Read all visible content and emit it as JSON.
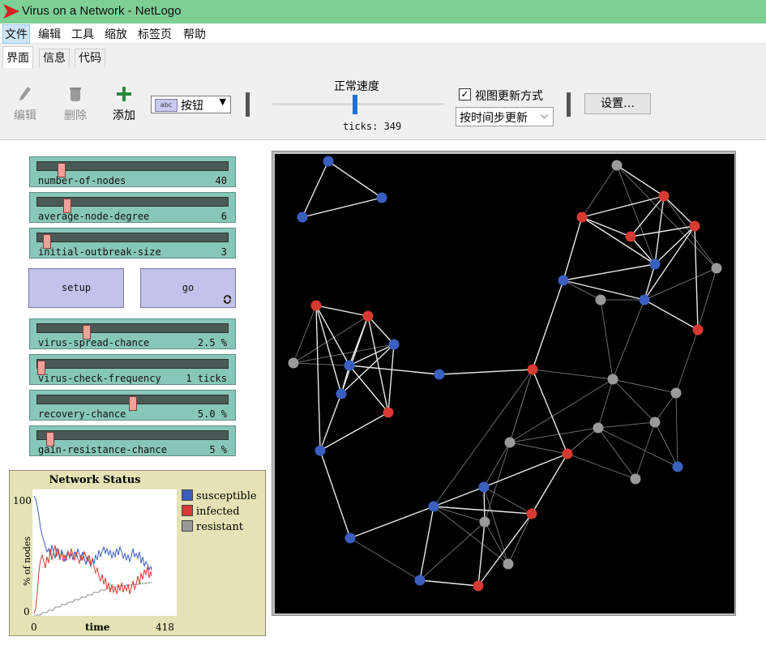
{
  "window": {
    "title": "Virus on a Network - NetLogo"
  },
  "menu": [
    "文件",
    "编辑",
    "工具",
    "缩放",
    "标签页",
    "帮助"
  ],
  "tabs": [
    "界面",
    "信息",
    "代码"
  ],
  "toolbar": {
    "edit_label": "编辑",
    "delete_label": "删除",
    "add_label": "添加",
    "widget_type": "按钮",
    "speed_label": "正常速度",
    "speed_level": 0.48,
    "ticks_label": "ticks: 349",
    "view_update_label": "视图更新方式",
    "view_update_checked": true,
    "update_mode": "按时间步更新",
    "settings_label": "设置…"
  },
  "sliders": [
    {
      "name": "number-of-nodes",
      "value": "40",
      "level": 0.11
    },
    {
      "name": "average-node-degree",
      "value": "6",
      "level": 0.14
    },
    {
      "name": "initial-outbreak-size",
      "value": "3",
      "level": 0.03
    },
    {
      "name": "virus-spread-chance",
      "value": "2.5 %",
      "level": 0.25
    },
    {
      "name": "virus-check-frequency",
      "value": "1 ticks",
      "level": 0.0
    },
    {
      "name": "recovery-chance",
      "value": "5.0 %",
      "level": 0.5
    },
    {
      "name": "gain-resistance-chance",
      "value": "5 %",
      "level": 0.05
    }
  ],
  "buttons": {
    "setup": "setup",
    "go": "go"
  },
  "plot": {
    "title": "Network Status",
    "ylabel": "% of nodes",
    "xlabel": "time",
    "xmin": "0",
    "xmax": "418",
    "ymin": "0",
    "ymax": "100",
    "legend": [
      {
        "name": "susceptible",
        "color": "#3b5fbf"
      },
      {
        "name": "infected",
        "color": "#d63a32"
      },
      {
        "name": "resistant",
        "color": "#9a9a9a"
      }
    ]
  },
  "colors": {
    "susceptible": "#3b5fbf",
    "infected": "#d63a32",
    "resistant": "#9a9a9a",
    "slider_bg": "#87c7b9",
    "button_bg": "#c3c2ea",
    "plot_bg": "#e5e3b5",
    "title_bar": "#7dcf95"
  }
}
